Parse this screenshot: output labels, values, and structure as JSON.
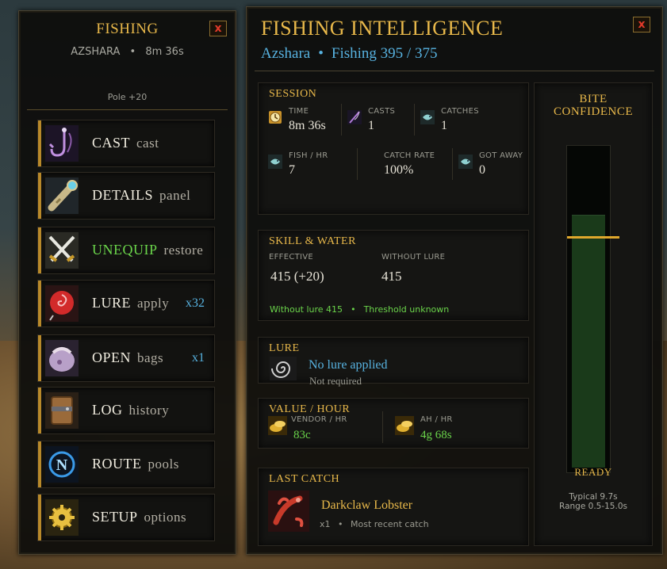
{
  "left": {
    "title": "FISHING",
    "zone": "AZSHARA",
    "separator": "•",
    "elapsed": "8m 36s",
    "pole": "Pole +20",
    "close": "x",
    "menu": [
      {
        "label": "CAST",
        "sub": "cast",
        "badge": "",
        "icon": "fishing-hook-icon",
        "label_color": "#f0ecdf"
      },
      {
        "label": "DETAILS",
        "sub": "panel",
        "badge": "",
        "icon": "spyglass-icon",
        "label_color": "#f0ecdf"
      },
      {
        "label": "UNEQUIP",
        "sub": "restore",
        "badge": "",
        "icon": "crossed-swords-icon",
        "label_color": "#6ad44a"
      },
      {
        "label": "LURE",
        "sub": "apply",
        "badge": "x32",
        "icon": "lure-bobber-icon",
        "label_color": "#f0ecdf"
      },
      {
        "label": "OPEN",
        "sub": "bags",
        "badge": "x1",
        "icon": "bag-icon",
        "label_color": "#f0ecdf"
      },
      {
        "label": "LOG",
        "sub": "history",
        "badge": "",
        "icon": "journal-icon",
        "label_color": "#f0ecdf"
      },
      {
        "label": "ROUTE",
        "sub": "pools",
        "badge": "",
        "icon": "compass-icon",
        "label_color": "#f0ecdf"
      },
      {
        "label": "SETUP",
        "sub": "options",
        "badge": "",
        "icon": "gear-icon",
        "label_color": "#f0ecdf"
      }
    ]
  },
  "right": {
    "title": "FISHING INTELLIGENCE",
    "zone": "Azshara",
    "separator": "•",
    "skill": "Fishing 395 / 375",
    "close": "x",
    "session": {
      "title": "SESSION",
      "time_label": "TIME",
      "time": "8m 36s",
      "casts_label": "CASTS",
      "casts": "1",
      "catches_label": "CATCHES",
      "catches": "1",
      "fish_hr_label": "FISH / HR",
      "fish_hr": "7",
      "catch_rate_label": "CATCH RATE",
      "catch_rate": "100%",
      "got_away_label": "GOT AWAY",
      "got_away": "0"
    },
    "skill_water": {
      "title": "SKILL & WATER",
      "effective_label": "EFFECTIVE",
      "effective": "415  (+20)",
      "without_lure_label": "WITHOUT LURE",
      "without_lure": "415",
      "note_left": "Without lure 415",
      "note_sep": "•",
      "note_right": "Threshold unknown"
    },
    "lure": {
      "title": "LURE",
      "status": "No lure applied",
      "note": "Not required"
    },
    "value": {
      "title": "VALUE / HOUR",
      "vendor_label": "VENDOR / HR",
      "vendor": "83c",
      "ah_label": "AH / HR",
      "ah": "4g 68s"
    },
    "last_catch": {
      "title": "LAST CATCH",
      "name": "Darkclaw Lobster",
      "count": "x1",
      "sep": "•",
      "note": "Most recent catch"
    },
    "bite": {
      "title_line1": "BITE",
      "title_line2": "CONFIDENCE",
      "fill_fraction": 0.795,
      "marker_fraction": 0.27,
      "ready": "READY",
      "typical": "Typical 9.7s",
      "range": "Range 0.5-15.0s"
    }
  },
  "colors": {
    "gold": "#e8b84a",
    "blue": "#57b2e0",
    "green": "#6ad44a",
    "close_red": "#e23a2a"
  }
}
